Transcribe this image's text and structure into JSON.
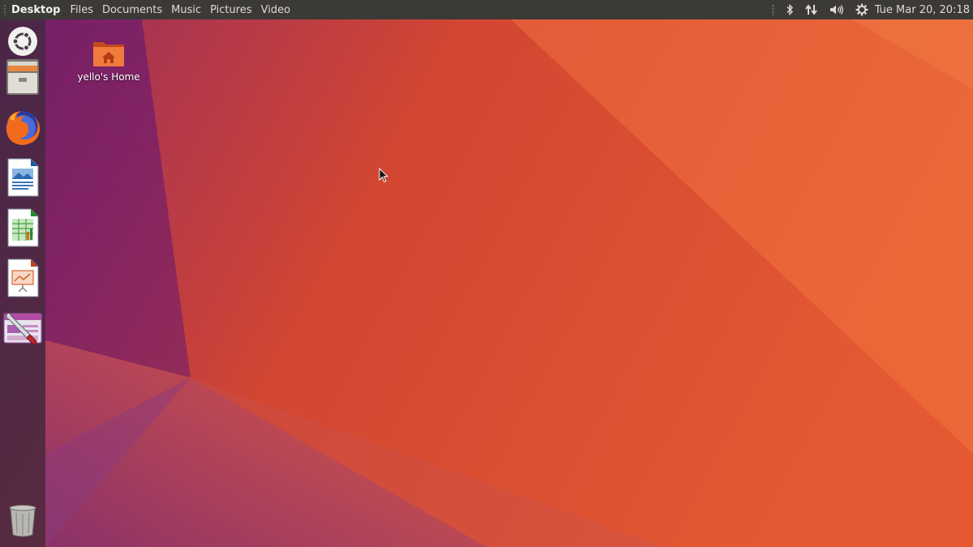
{
  "top_panel": {
    "app_title": "Desktop",
    "menus": [
      "Files",
      "Documents",
      "Music",
      "Pictures",
      "Video"
    ],
    "indicators": [
      "bluetooth-icon",
      "network-icon",
      "volume-icon",
      "system-gear-icon"
    ],
    "clock": "Tue Mar 20, 20:18"
  },
  "launcher": {
    "items": [
      "ubuntu-dash-icon",
      "files-icon",
      "firefox-icon",
      "libreoffice-writer-icon",
      "libreoffice-calc-icon",
      "libreoffice-impress-icon",
      "system-settings-icon"
    ],
    "trash": "trash-icon"
  },
  "desktop": {
    "home_icon_label": "yello's Home"
  },
  "colors": {
    "panel_bg": "#3b3a36",
    "wallpaper_orange": "#e95c2f",
    "wallpaper_purple": "#77216f"
  }
}
